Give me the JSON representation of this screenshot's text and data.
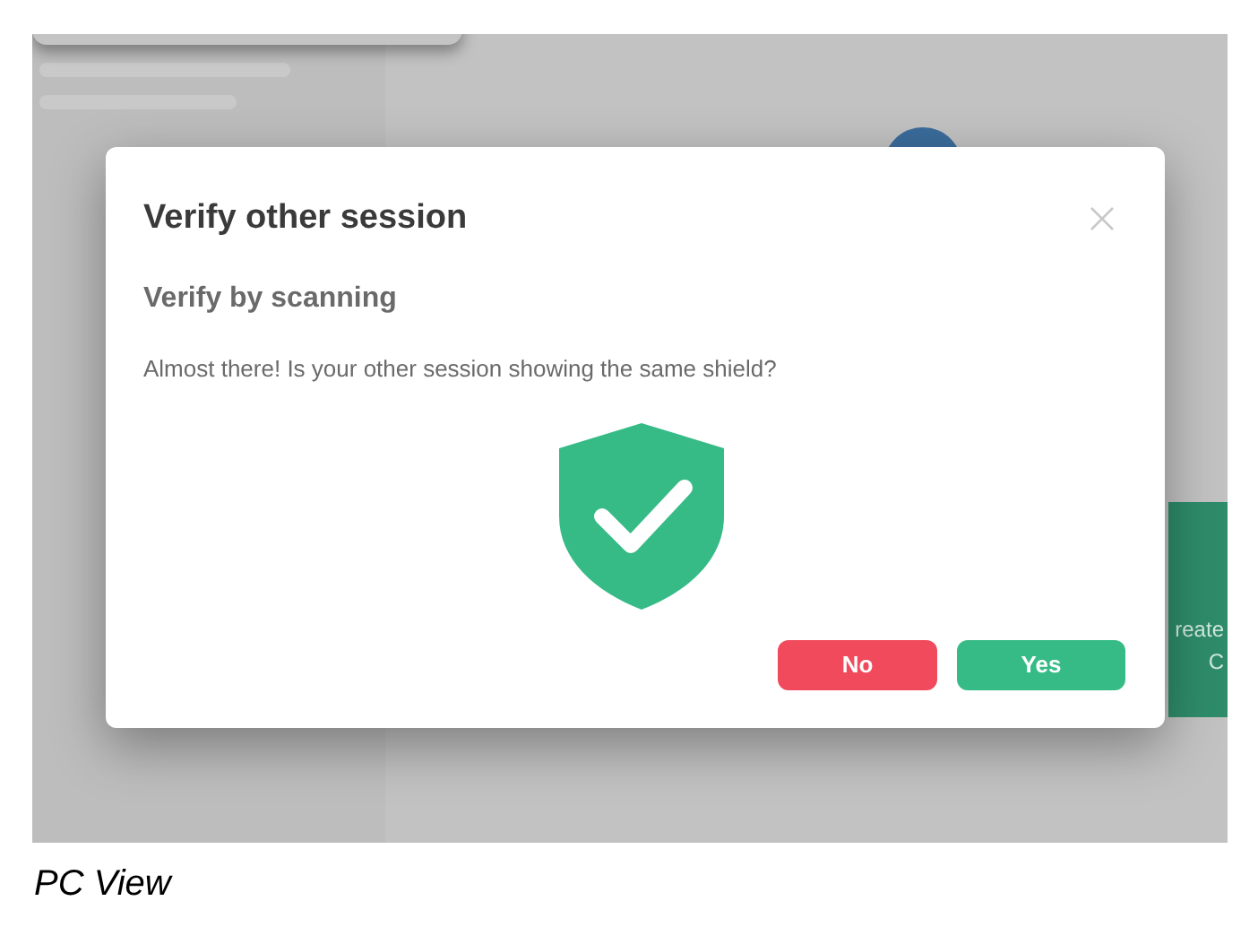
{
  "dialog": {
    "title": "Verify other session",
    "subtitle": "Verify by scanning",
    "message": "Almost there! Is your other session showing the same shield?",
    "buttons": [
      {
        "label": "No",
        "kind": "danger"
      },
      {
        "label": "Yes",
        "kind": "primary"
      }
    ]
  },
  "background_card": {
    "lines": [
      "reate",
      "C"
    ]
  },
  "caption": "PC View"
}
